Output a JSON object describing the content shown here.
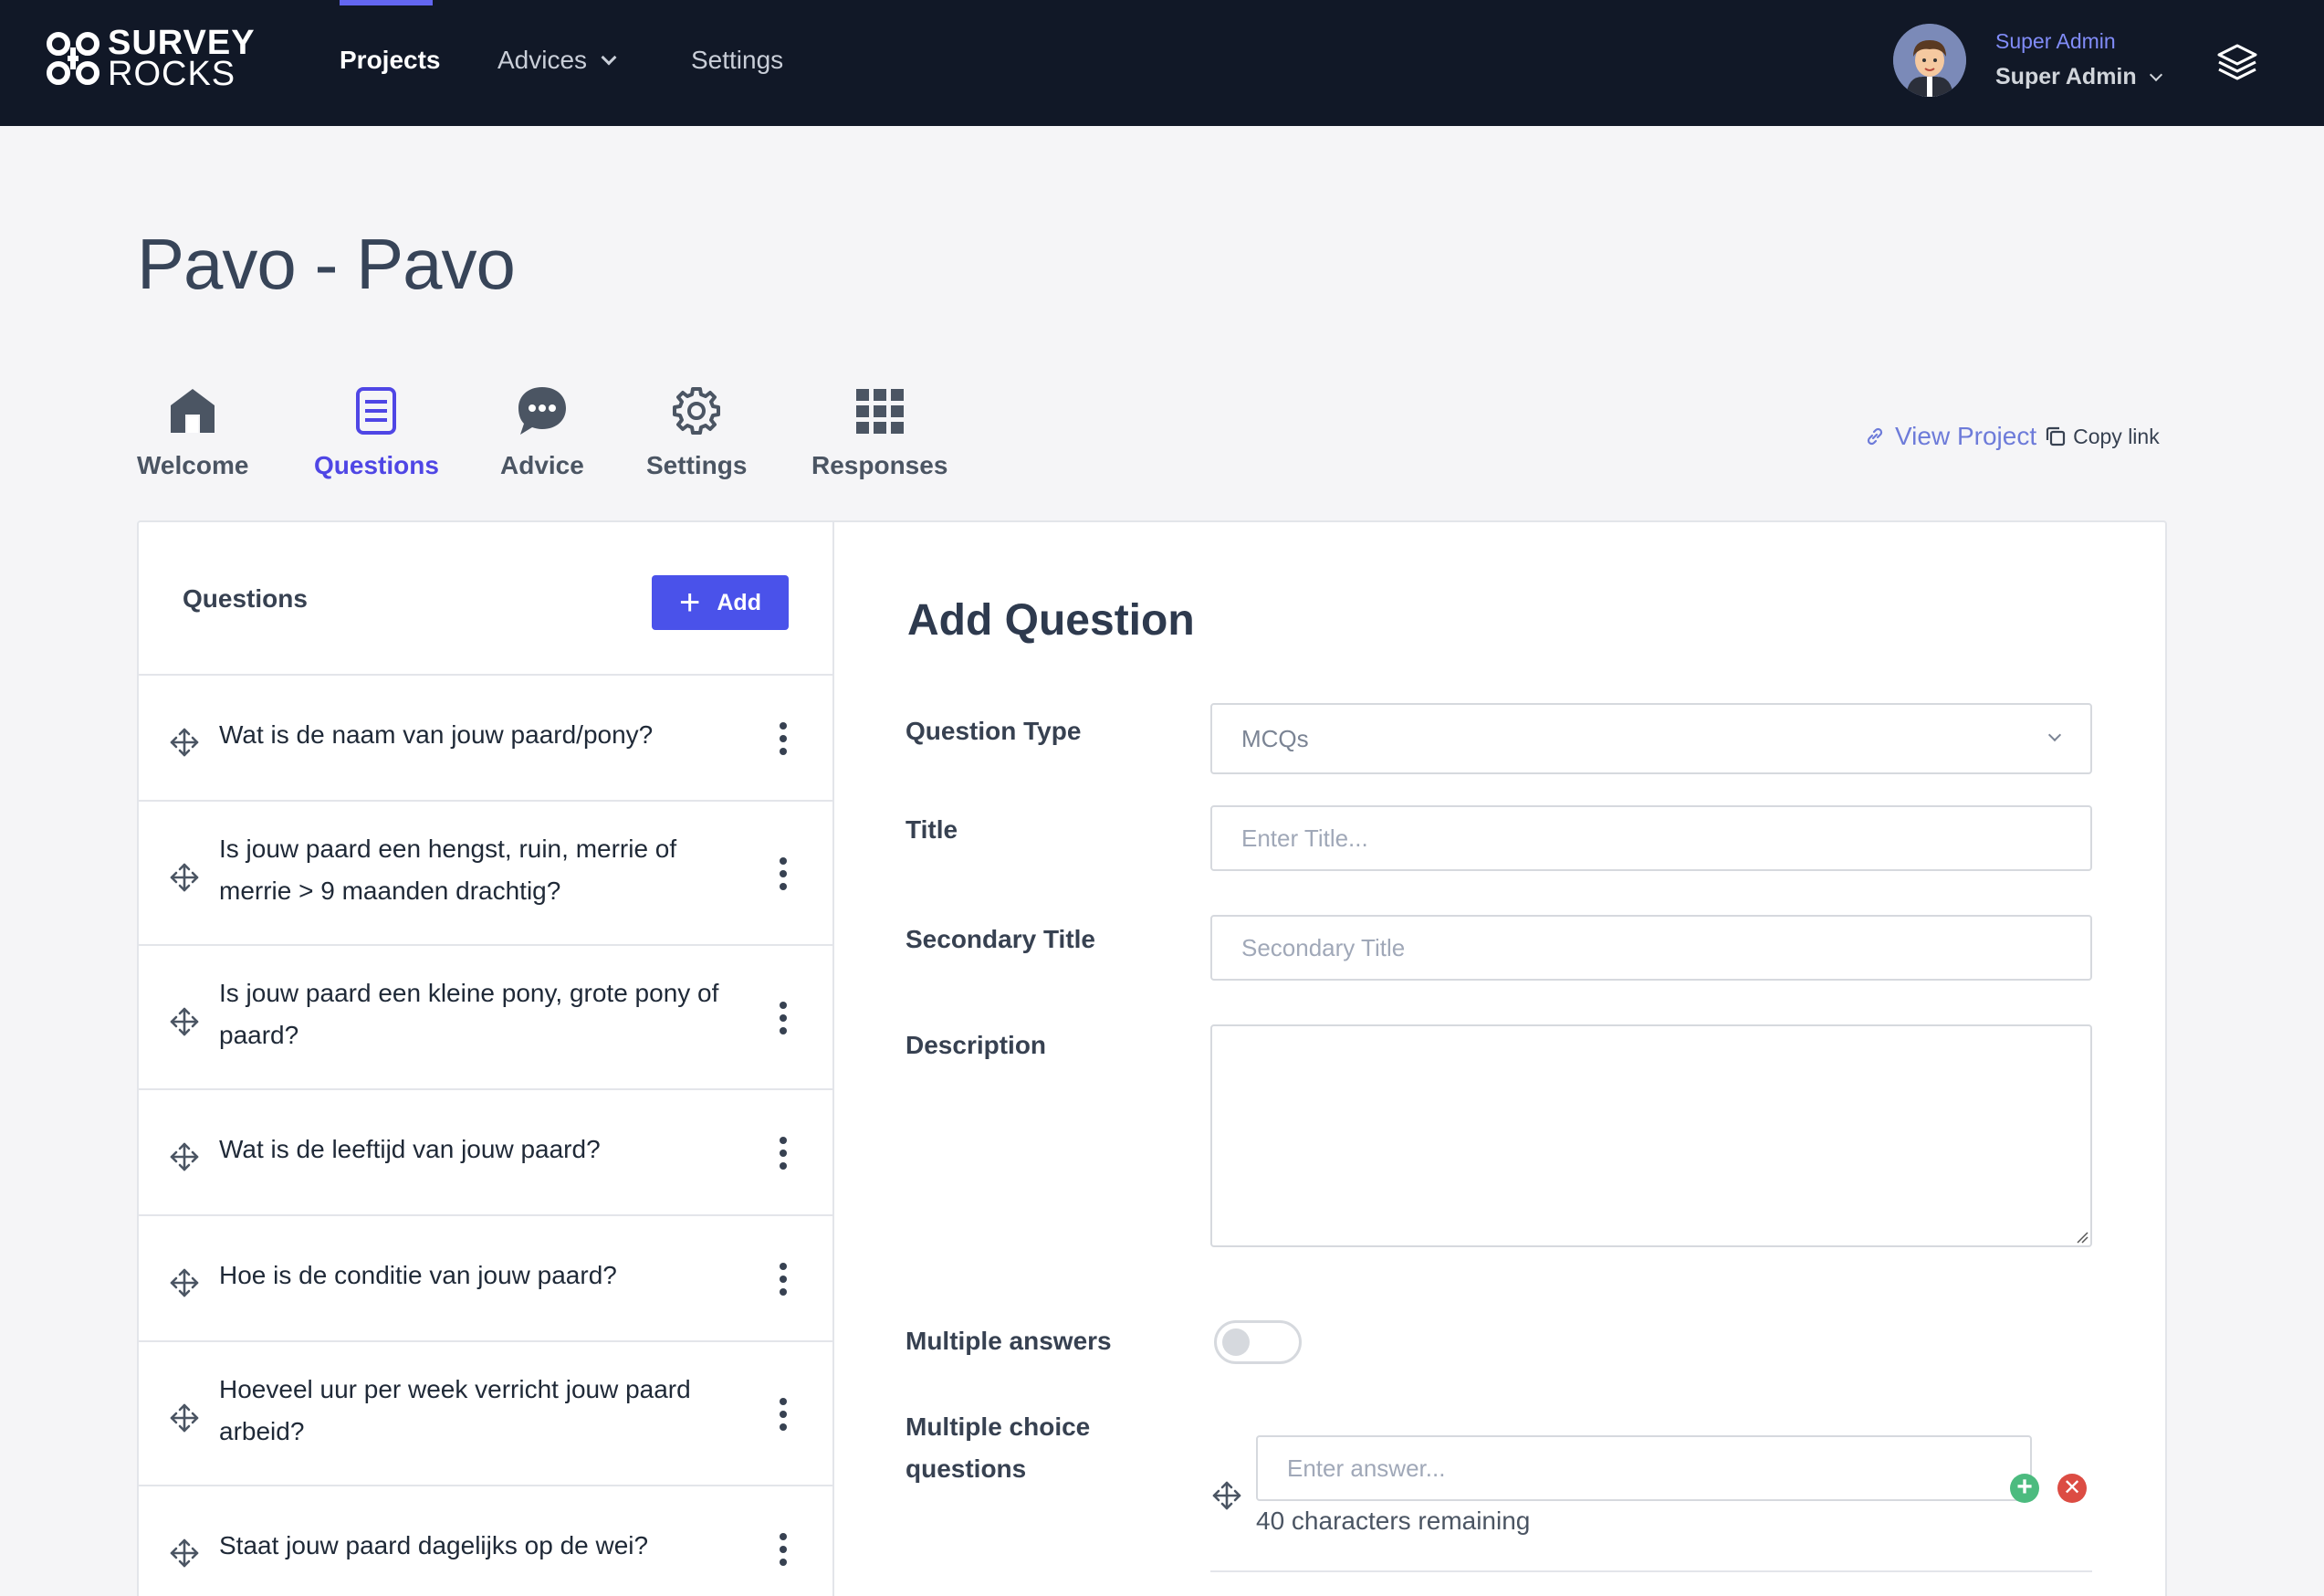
{
  "app": {
    "logo_line1": "SURVEY",
    "logo_line2": "ROCKS"
  },
  "nav": {
    "projects": "Projects",
    "advices": "Advices",
    "settings": "Settings"
  },
  "user": {
    "role": "Super Admin",
    "name": "Super Admin"
  },
  "page": {
    "title": "Pavo - Pavo"
  },
  "tabs": [
    {
      "label": "Welcome",
      "icon": "home-icon"
    },
    {
      "label": "Questions",
      "icon": "document-list-icon",
      "active": true
    },
    {
      "label": "Advice",
      "icon": "chat-bubble-icon"
    },
    {
      "label": "Settings",
      "icon": "gear-icon"
    },
    {
      "label": "Responses",
      "icon": "grid-icon"
    }
  ],
  "project_links": {
    "view_project": "View Project",
    "copy_link": "Copy link"
  },
  "questions_panel": {
    "title": "Questions",
    "add_label": "Add",
    "items": [
      "Wat is de naam van jouw paard/pony?",
      "Is jouw paard een hengst, ruin, merrie of merrie > 9 maanden drachtig?",
      "Is jouw paard een kleine pony, grote pony of paard?",
      "Wat is de leeftijd van jouw paard?",
      "Hoe is de conditie van jouw paard?",
      "Hoeveel uur per week verricht jouw paard arbeid?",
      "Staat jouw paard dagelijks op de wei?"
    ]
  },
  "form": {
    "heading": "Add Question",
    "question_type_label": "Question Type",
    "question_type_value": "MCQs",
    "title_label": "Title",
    "title_placeholder": "Enter Title...",
    "secondary_title_label": "Secondary Title",
    "secondary_title_placeholder": "Secondary Title",
    "description_label": "Description",
    "multiple_answers_label": "Multiple answers",
    "multiple_answers_on": false,
    "mcq_label_line1": "Multiple choice",
    "mcq_label_line2": "questions",
    "answer_placeholder": "Enter answer...",
    "chars_remaining": "40 characters remaining"
  },
  "colors": {
    "topbar": "#111827",
    "accent": "#4a52ea",
    "active_tab": "#4f46e5",
    "link": "#6d7bd9",
    "add_answer": "#4cbb7f",
    "remove_answer": "#dc4c43"
  }
}
